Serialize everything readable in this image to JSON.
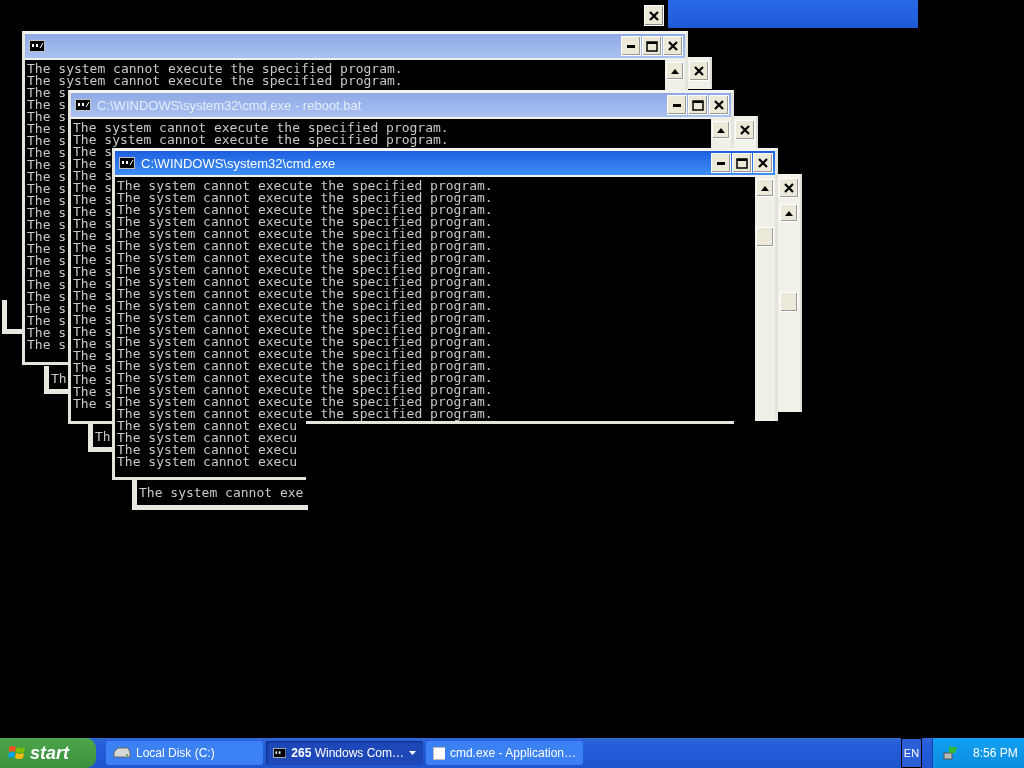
{
  "windows": [
    {
      "active": false,
      "lines": [
        "The system cannot execute the specified program.",
        "The system cannot execute the specified program.",
        "The s",
        "The s",
        "The s",
        "The s",
        "The s",
        "The s",
        "The s",
        "The s",
        "The s",
        "The s",
        "The s",
        "The s",
        "The s",
        "The s",
        "The s",
        "The s",
        "The s",
        "The s",
        "The s",
        "The s",
        "The s",
        "The s"
      ]
    },
    {
      "title": "C:\\WINDOWS\\system32\\cmd.exe - reboot.bat",
      "active": false,
      "lines": [
        "The system cannot execute the specified program.",
        "The system cannot execute the specified program.",
        "The s",
        "The s",
        "The s",
        "The s",
        "The s",
        "The s",
        "The s",
        "The s",
        "The s",
        "The s",
        "The s",
        "The s",
        "The s",
        "The s",
        "The s",
        "The s",
        "The s",
        "The s",
        "The s",
        "The s",
        "The s",
        "The s"
      ]
    },
    {
      "title": "C:\\WINDOWS\\system32\\cmd.exe",
      "active": true,
      "lines": [
        "The system cannot execute the specified program.",
        "The system cannot execute the specified program.",
        "The system cannot execute the specified program.",
        "The system cannot execute the specified program.",
        "The system cannot execute the specified program.",
        "The system cannot execute the specified program.",
        "The system cannot execute the specified program.",
        "The system cannot execute the specified program.",
        "The system cannot execute the specified program.",
        "The system cannot execute the specified program.",
        "The system cannot execute the specified program.",
        "The system cannot execute the specified program.",
        "The system cannot execute the specified program.",
        "The system cannot execute the specified program.",
        "The system cannot execute the specified program.",
        "The system cannot execute the specified program.",
        "The system cannot execute the specified program.",
        "The system cannot execute the specified program.",
        "The system cannot execute the specified program.",
        "The system cannot execute the specified program.",
        "The system cannot execu",
        "The system cannot execu",
        "The system cannot execu",
        "The system cannot execu"
      ]
    }
  ],
  "remnants": [
    {
      "text": "Th"
    },
    {
      "text": "Th"
    },
    {
      "text": "The system cannot exe"
    }
  ],
  "taskbar": {
    "start": "start",
    "tasks": [
      {
        "kind": "drive",
        "label": "Local Disk (C:)",
        "selected": false
      },
      {
        "kind": "group",
        "label": "**265** Windows Com…",
        "selected": true
      },
      {
        "kind": "app",
        "label": "cmd.exe - Application…",
        "selected": false
      }
    ],
    "language": "EN",
    "clock": "8:56 PM"
  }
}
